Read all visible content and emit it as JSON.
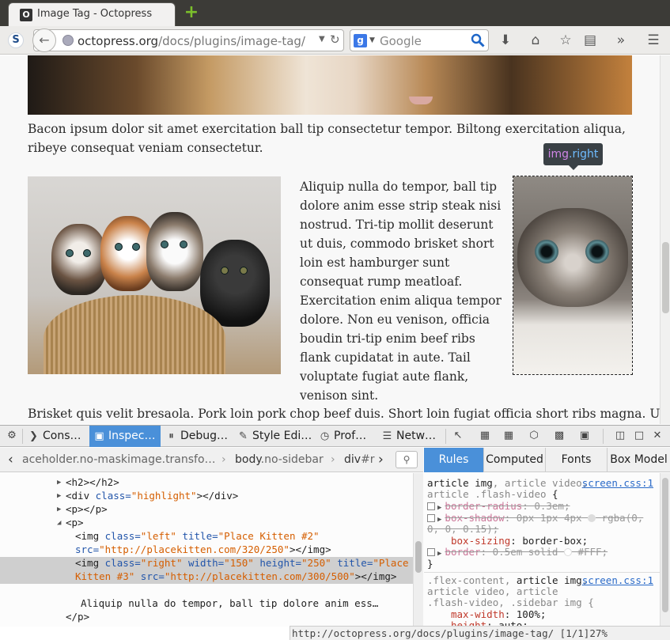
{
  "tab": {
    "title": "Image Tag - Octopress",
    "favicon_letter": "O"
  },
  "navbar": {
    "url_domain": "octopress.org",
    "url_path": "/docs/plugins/image-tag/",
    "search_placeholder": "Google"
  },
  "page": {
    "paragraph1": "Bacon ipsum dolor sit amet exercitation ball tip consectetur tempor. Biltong exercitation aliqua, ribeye consequat veniam consectetur.",
    "paragraph2": "Aliquip nulla do tempor, ball tip dolore anim esse strip steak nisi nostrud. Tri-tip mollit deserunt ut duis, commodo brisket short loin est hamburger sunt consequat rump meatloaf. Exercitation enim aliqua tempor dolore. Non eu venison, officia boudin tri-tip enim beef ribs flank cupidatat in aute. Tail voluptate fugiat aute flank, venison sint.",
    "paragraph3": "Brisket quis velit bresaola. Pork loin pork chop beef duis. Short loin fugiat officia short ribs magna. Ullamco",
    "tooltip_tag": "img",
    "tooltip_class": ".right"
  },
  "devtools": {
    "tabs": [
      "Cons…",
      "Inspec…",
      "Debug…",
      "Style Edi…",
      "Prof…",
      "Netw…"
    ],
    "breadcrumbs": {
      "first": "aceholder.no-maskimage.transfo…",
      "second_tag": "body",
      "second_class": ".no-sidebar",
      "third_tag": "div",
      "third_rest": "#r"
    },
    "side_tabs": [
      "Rules",
      "Computed",
      "Fonts",
      "Box Model"
    ],
    "markup": {
      "h2": "<h2></h2>",
      "div_open": "<div ",
      "div_attr": "class=",
      "div_val": "\"highlight\"",
      "div_close": "></div>",
      "p_empty": "<p></p>",
      "p_open": "<p>",
      "img_left_1": "<img ",
      "img_left_class": "class=",
      "img_left_class_val": "\"left\"",
      "img_left_title": " title=",
      "img_left_title_val": "\"Place Kitten #2\"",
      "img_left_src": "src=",
      "img_left_src_val": "\"http://placekitten.com/320/250\"",
      "img_left_end": "></img>",
      "img_right_1": "<img ",
      "img_right_class": "class=",
      "img_right_class_val": "\"right\"",
      "img_right_width": " width=",
      "img_right_width_val": "\"150\"",
      "img_right_height": " height=",
      "img_right_height_val": "\"250\"",
      "img_right_title": " title=",
      "img_right_title_val_a": "\"Place",
      "img_right_title_val_b": "Kitten #3\"",
      "img_right_src": " src=",
      "img_right_src_val": "\"http://placekitten.com/300/500\"",
      "img_right_end": "></img>",
      "text_node": "Aliquip nulla do tempor, ball tip dolore anim ess…",
      "p_close": "</p>"
    },
    "rules": {
      "r1_sel_a": "article img",
      "r1_sel_b": ", article video,",
      "r1_src": "screen.css:1",
      "r1_sel_c": "article .flash-video",
      "r1_brace": " {",
      "r1_p1_name": "border-radius",
      "r1_p1_val": ": 0.3em;",
      "r1_p2_name": "box-shadow",
      "r1_p2_val_a": ": 0px 1px 4px",
      "r1_p2_val_b": "rgba(0,",
      "r1_p2_val_c": "0, 0, 0.15);",
      "r1_p3_name": "box-sizing",
      "r1_p3_val": ": border-box;",
      "r1_p4_name": "border",
      "r1_p4_val_a": ": 0.5em solid",
      "r1_p4_val_b": "#FFF;",
      "r1_close": "}",
      "r2_sel_a": ".flex-content, ",
      "r2_sel_b": "article img",
      "r2_sel_c": ",",
      "r2_src": "screen.css:1",
      "r2_sel_d": "article video, article",
      "r2_sel_e": ".flash-video, .sidebar img {",
      "r2_p1_name": "max-width",
      "r2_p1_val": ": 100%;",
      "r2_p2_name": "height",
      "r2_p2_val": ": auto;"
    }
  },
  "statusbar": {
    "url": "http://octopress.org/docs/plugins/image-tag/",
    "page": "[1/1]",
    "percent": "27%"
  },
  "colors": {
    "devtools_active": "#4a90d9",
    "attr_name": "#2255aa",
    "attr_value": "#d55e00",
    "css_property": "#c0392b"
  }
}
